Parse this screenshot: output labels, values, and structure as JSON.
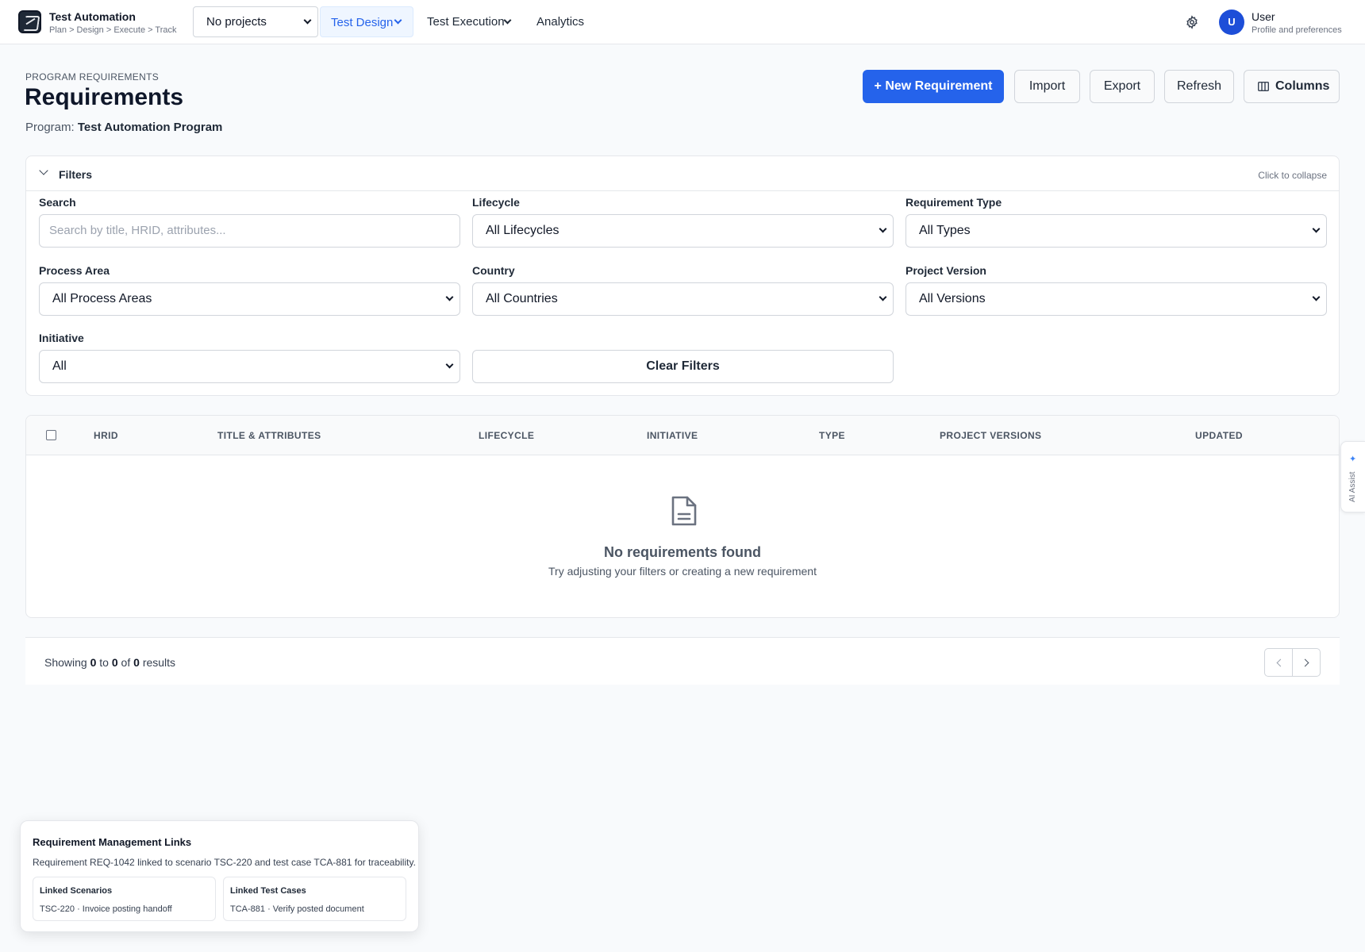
{
  "app": {
    "title": "Test Automation",
    "subtitle": "Plan > Design > Execute > Track",
    "project_select": "No projects"
  },
  "nav": {
    "items": [
      {
        "label": "Test Design",
        "active": true,
        "has_dropdown": true
      },
      {
        "label": "Test Execution",
        "active": false,
        "has_dropdown": true
      },
      {
        "label": "Analytics",
        "active": false,
        "has_dropdown": false
      }
    ],
    "settings_icon": "gear-icon"
  },
  "user": {
    "initial": "U",
    "name": "User",
    "subtitle": "Profile and preferences"
  },
  "header": {
    "eyebrow": "PROGRAM REQUIREMENTS",
    "title": "Requirements",
    "program_prefix": "Program:",
    "program_name": "Test Automation Program"
  },
  "actions": {
    "new": "+ New Requirement",
    "import": "Import",
    "export": "Export",
    "refresh": "Refresh",
    "columns": "Columns"
  },
  "filters": {
    "title": "Filters",
    "hint": "Click to collapse",
    "search": {
      "label": "Search",
      "placeholder": "Search by title, HRID, attributes..."
    },
    "lifecycle": {
      "label": "Lifecycle",
      "value": "All Lifecycles"
    },
    "requirement_type": {
      "label": "Requirement Type",
      "value": "All Types"
    },
    "process_area": {
      "label": "Process Area",
      "value": "All Process Areas"
    },
    "country": {
      "label": "Country",
      "value": "All Countries"
    },
    "project_version": {
      "label": "Project Version",
      "value": "All Versions"
    },
    "initiative": {
      "label": "Initiative",
      "value": "All"
    },
    "clear": "Clear Filters"
  },
  "table": {
    "columns": [
      "HRID",
      "TITLE & ATTRIBUTES",
      "LIFECYCLE",
      "INITIATIVE",
      "TYPE",
      "PROJECT VERSIONS",
      "UPDATED"
    ],
    "empty_title": "No requirements found",
    "empty_sub": "Try adjusting your filters or creating a new requirement"
  },
  "pagination": {
    "showing": "Showing",
    "from": "0",
    "to_word": "to",
    "to": "0",
    "of_word": "of",
    "total": "0",
    "results": "results"
  },
  "ai_assist": {
    "label": "AI Assist"
  },
  "links_card": {
    "title": "Requirement Management Links",
    "description": "Requirement REQ-1042 linked to scenario TSC-220 and test case TCA-881 for traceability.",
    "scenarios": {
      "label": "Linked Scenarios",
      "value": "TSC-220 · Invoice posting handoff"
    },
    "test_cases": {
      "label": "Linked Test Cases",
      "value": "TCA-881 · Verify posted document"
    }
  },
  "colors": {
    "primary": "#2563eb",
    "nav_active_bg": "#eff6ff",
    "avatar": "#1d4ed8",
    "page_bg": "#f8fafc"
  }
}
